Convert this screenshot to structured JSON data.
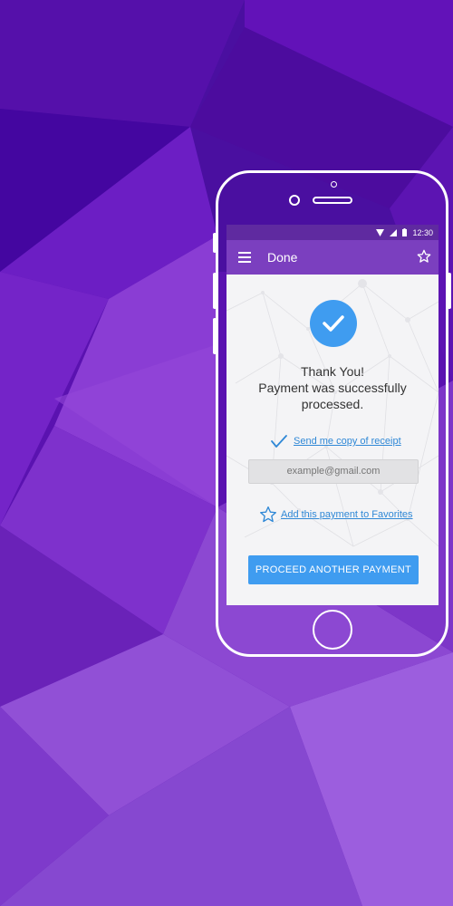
{
  "status_bar": {
    "time": "12:30"
  },
  "app_bar": {
    "title": "Done"
  },
  "confirmation": {
    "line1": "Thank You!",
    "line2": "Payment was successfully",
    "line3": "processed."
  },
  "receipt": {
    "label": "Send me copy of receipt"
  },
  "email_field": {
    "placeholder": "example@gmail.com"
  },
  "favorites": {
    "label": "Add this payment to Favorites"
  },
  "proceed_button": {
    "label": "PROCEED ANOTHER PAYMENT"
  },
  "colors": {
    "primary": "#7b3fbf",
    "accent": "#3f9cf0",
    "background": "#5a12b0"
  }
}
